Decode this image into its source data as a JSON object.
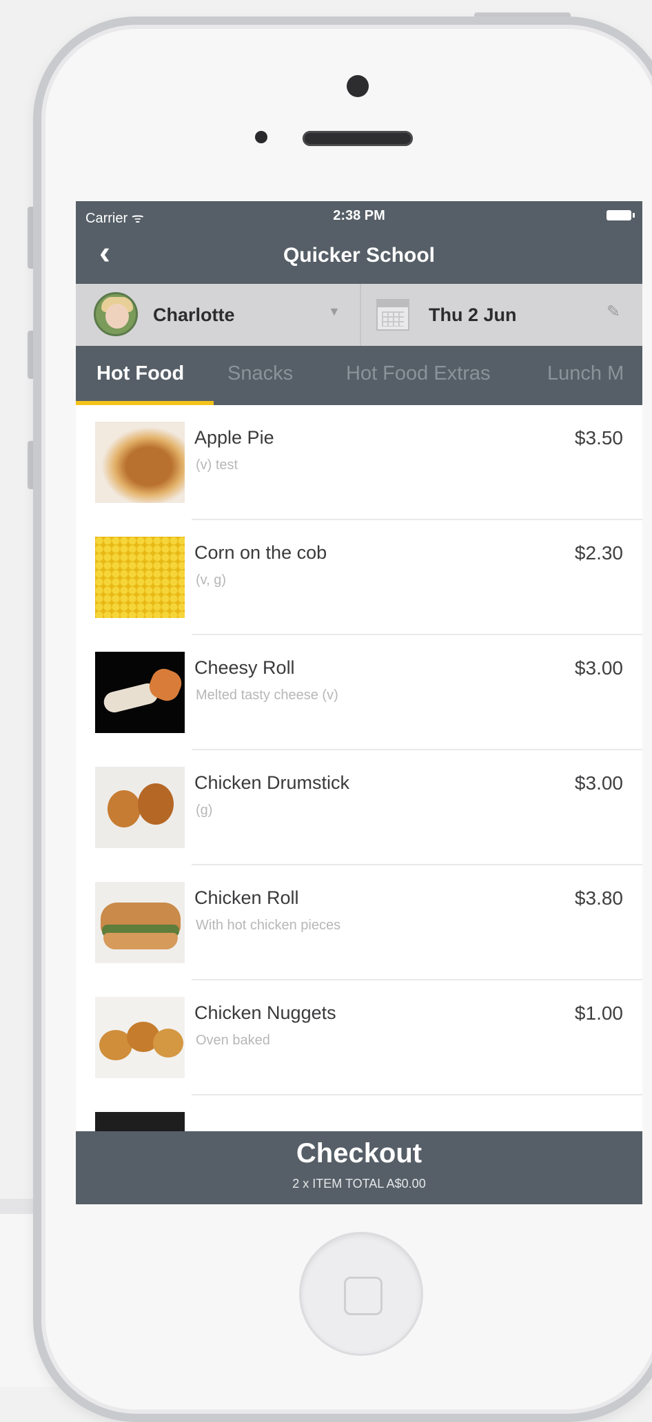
{
  "status_bar": {
    "carrier": "Carrier ᯤ",
    "time": "2:38 PM"
  },
  "nav": {
    "back_icon": "‹",
    "title": "Quicker School"
  },
  "selector": {
    "student_name": "Charlotte",
    "dropdown_icon": "▼",
    "date": "Thu 2 Jun",
    "edit_icon": "✎"
  },
  "tabs": [
    {
      "label": "Hot Food",
      "active": true
    },
    {
      "label": "Snacks",
      "active": false
    },
    {
      "label": "Hot Food Extras",
      "active": false
    },
    {
      "label": "Lunch M",
      "active": false
    }
  ],
  "menu_items": [
    {
      "name": "Apple Pie",
      "description": "(v) test",
      "price": "$3.50",
      "image": "apple-pie"
    },
    {
      "name": "Corn on the cob",
      "description": "(v, g)",
      "price": "$2.30",
      "image": "corn"
    },
    {
      "name": "Cheesy Roll",
      "description": "Melted tasty cheese (v)",
      "price": "$3.00",
      "image": "cheesy-roll"
    },
    {
      "name": "Chicken Drumstick",
      "description": "(g)",
      "price": "$3.00",
      "image": "drumstick"
    },
    {
      "name": "Chicken Roll",
      "description": "With hot chicken pieces",
      "price": "$3.80",
      "image": "chicken-roll"
    },
    {
      "name": "Chicken Nuggets",
      "description": "Oven baked",
      "price": "$1.00",
      "image": "nuggets"
    }
  ],
  "checkout": {
    "label": "Checkout",
    "summary": "2 x ITEM  TOTAL A$0.00"
  },
  "colors": {
    "bar": "#565f67",
    "tab_indicator": "#f4c21a",
    "selector_bg": "#d4d4d6"
  }
}
